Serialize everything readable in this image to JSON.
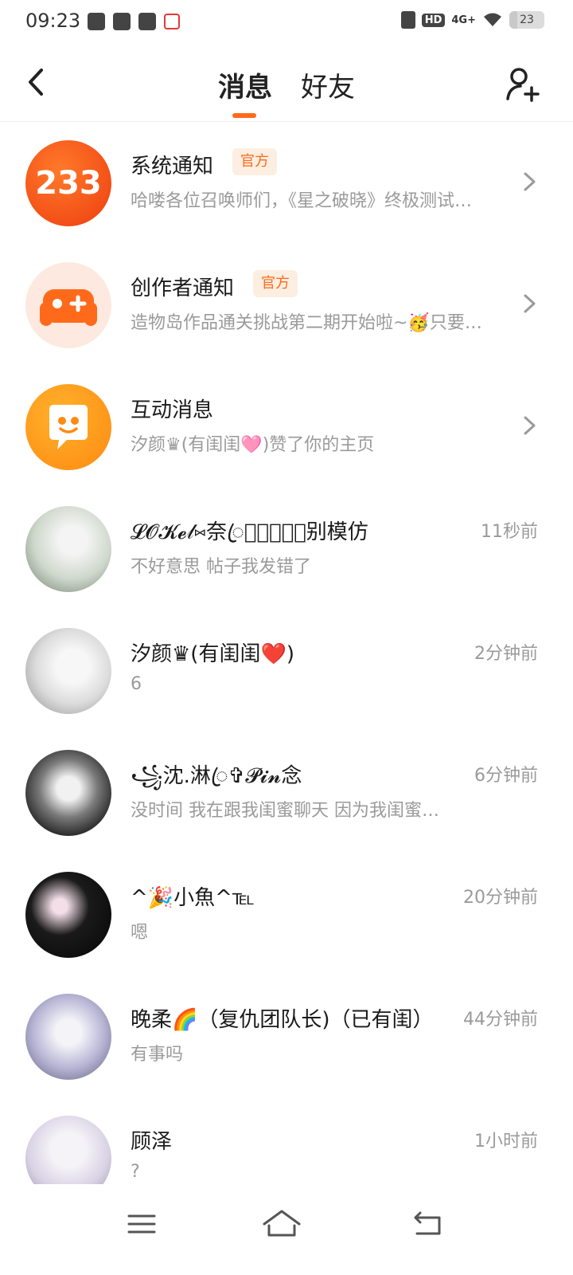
{
  "status_bar": {
    "time": "09:23",
    "hd": "HD",
    "network": "4G+",
    "battery": "23"
  },
  "header": {
    "tabs": [
      {
        "label": "消息",
        "active": true
      },
      {
        "label": "好友",
        "active": false
      }
    ],
    "accent_color": "#ff6a1a"
  },
  "messages": [
    {
      "avatar": "233-logo",
      "title": "系统通知",
      "badge": "官方",
      "preview": "哈喽各位召唤师们，《星之破晓》终极测试…",
      "chevron": true
    },
    {
      "avatar": "gamepad-icon",
      "title": "创作者通知",
      "badge": "官方",
      "preview": "造物岛作品通关挑战第二期开始啦~🥳只要…",
      "chevron": true
    },
    {
      "avatar": "chat-bubble-icon",
      "title": "互动消息",
      "preview": "汐颜♛(有闺闺🩷)赞了你的主页",
      "chevron": true
    },
    {
      "avatar": "user-avatar",
      "title": "𝓛𝓞𝓚𝓮𝓁⑅奈ꦿ𝓛𝓸𝓥𝓜ꦿ别模仿",
      "preview": "不好意思 帖子我发错了",
      "time": "11秒前"
    },
    {
      "avatar": "user-avatar",
      "title": "汐颜♛(有闺闺❤️)",
      "preview": "6",
      "time": "2分钟前"
    },
    {
      "avatar": "user-avatar",
      "title": "꧁沈.淋ꦿ✞𝓟𝓲𝓷念",
      "preview": "没时间 我在跟我闺蜜聊天 因为我闺蜜…",
      "time": "6分钟前"
    },
    {
      "avatar": "user-avatar",
      "title": "^🎉小魚^℡",
      "preview": "嗯",
      "time": "20分钟前"
    },
    {
      "avatar": "user-avatar",
      "title": "晚柔🌈（复仇团队长)（已有闺）",
      "preview": "有事吗",
      "time": "44分钟前"
    },
    {
      "avatar": "user-avatar",
      "title": "顾泽",
      "preview": "?",
      "time": "1小时前"
    }
  ]
}
